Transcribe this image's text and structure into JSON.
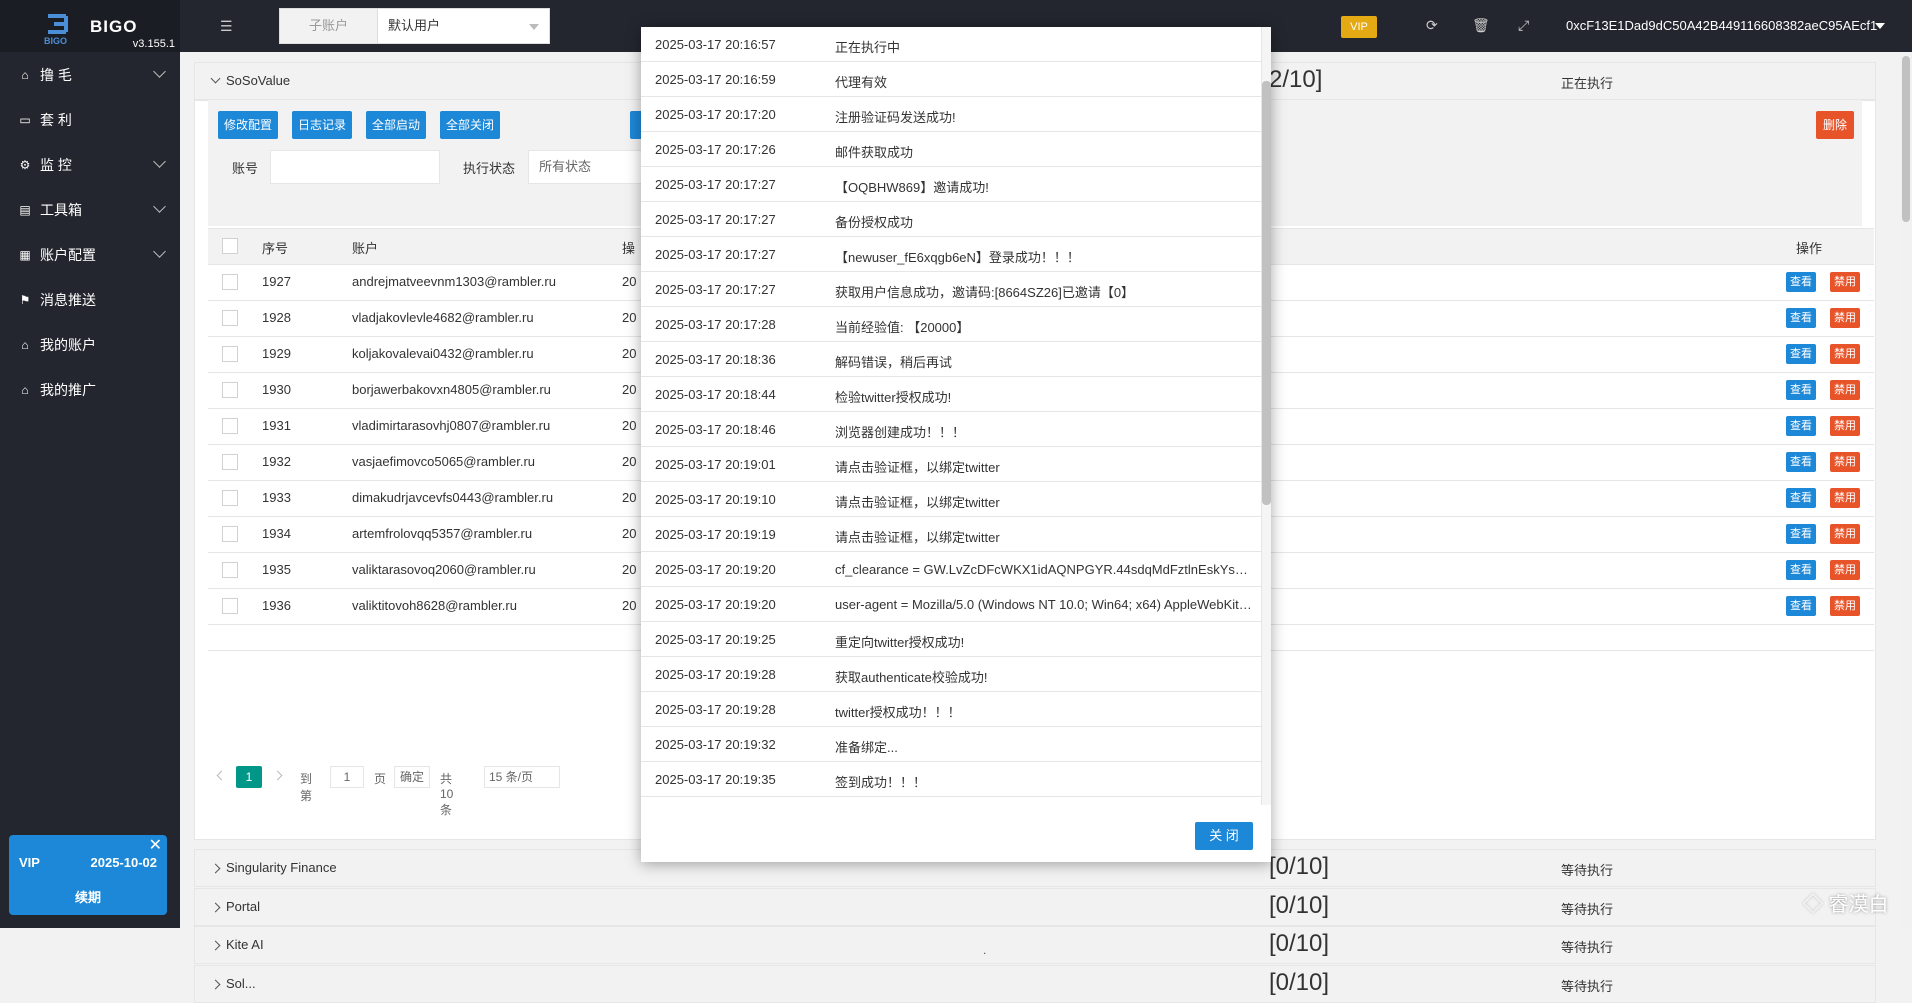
{
  "brand": {
    "name": "BIGO",
    "sub": "BIGO",
    "version": "v3.155.1"
  },
  "sidebar": {
    "items": [
      {
        "label": "撸 毛",
        "icon": "home-icon",
        "glyph": "⌂",
        "has_arrow": true
      },
      {
        "label": "套 利",
        "icon": "window-icon",
        "glyph": "▭",
        "has_arrow": false
      },
      {
        "label": "监 控",
        "icon": "gears-icon",
        "glyph": "⚙",
        "has_arrow": true
      },
      {
        "label": "工具箱",
        "icon": "file-icon",
        "glyph": "▤",
        "has_arrow": true
      },
      {
        "label": "账户配置",
        "icon": "calendar-icon",
        "glyph": "▦",
        "has_arrow": true
      },
      {
        "label": "消息推送",
        "icon": "flag-icon",
        "glyph": "⚑",
        "has_arrow": false
      },
      {
        "label": "我的账户",
        "icon": "home-icon",
        "glyph": "⌂",
        "has_arrow": false
      },
      {
        "label": "我的推广",
        "icon": "home-icon",
        "glyph": "⌂",
        "has_arrow": false
      }
    ],
    "vip": {
      "label": "VIP",
      "date": "2025-10-02",
      "renew": "续期",
      "close": "✕"
    }
  },
  "header": {
    "account_label": "子账户",
    "account_value": "默认用户",
    "vip_badge": "VIP",
    "wallet": "0xcF13E1Dad9dC50A42B449116608382aeC95AEcf1"
  },
  "sections": {
    "top": {
      "name": "SoSoValue",
      "progress": "2/10]",
      "status": "正在执行"
    },
    "others": [
      {
        "name": "Singularity Finance",
        "progress": "[0/10]",
        "status": "等待执行"
      },
      {
        "name": "Portal",
        "progress": "[0/10]",
        "status": "等待执行"
      },
      {
        "name": "Kite AI",
        "progress": "[0/10]",
        "status": "等待执行",
        "dot": "."
      },
      {
        "name": "Sol...",
        "progress": "[0/10]",
        "status": "等待执行"
      }
    ]
  },
  "toolbar": {
    "edit_config": "修改配置",
    "log_record": "日志记录",
    "start_all": "全部启动",
    "close_all": "全部关闭",
    "delete": "删除"
  },
  "filters": {
    "account_label": "账号",
    "account_value": "",
    "status_label": "执行状态",
    "status_value": "所有状态"
  },
  "table": {
    "headers": {
      "seq": "序号",
      "account": "账户",
      "op_partial": "操",
      "actions": "操作"
    },
    "rows": [
      {
        "seq": "1927",
        "account": "andrejmatveevnm1303@rambler.ru",
        "partial": "20"
      },
      {
        "seq": "1928",
        "account": "vladjakovlevle4682@rambler.ru",
        "partial": "20"
      },
      {
        "seq": "1929",
        "account": "koljakovalevai0432@rambler.ru",
        "partial": "20"
      },
      {
        "seq": "1930",
        "account": "borjawerbakovxn4805@rambler.ru",
        "partial": "20"
      },
      {
        "seq": "1931",
        "account": "vladimirtarasovhj0807@rambler.ru",
        "partial": "20"
      },
      {
        "seq": "1932",
        "account": "vasjaefimovco5065@rambler.ru",
        "partial": "20"
      },
      {
        "seq": "1933",
        "account": "dimakudrjavcevfs0443@rambler.ru",
        "partial": "20"
      },
      {
        "seq": "1934",
        "account": "artemfrolovqq5357@rambler.ru",
        "partial": "20"
      },
      {
        "seq": "1935",
        "account": "valiktarasovoq2060@rambler.ru",
        "partial": "20"
      },
      {
        "seq": "1936",
        "account": "valiktitovoh8628@rambler.ru",
        "partial": "20"
      }
    ],
    "view_label": "查看",
    "disable_label": "禁用"
  },
  "pager": {
    "current": "1",
    "goto": "到第",
    "page_input": "1",
    "page_unit": "页",
    "confirm": "确定",
    "total": "共 10 条",
    "per_page": "15 条/页"
  },
  "modal": {
    "close_label": "关 闭",
    "logs": [
      {
        "time": "2025-03-17 20:16:57",
        "msg": "正在执行中"
      },
      {
        "time": "2025-03-17 20:16:59",
        "msg": "代理有效"
      },
      {
        "time": "2025-03-17 20:17:20",
        "msg": "注册验证码发送成功!"
      },
      {
        "time": "2025-03-17 20:17:26",
        "msg": "邮件获取成功"
      },
      {
        "time": "2025-03-17 20:17:27",
        "msg": "【OQBHW869】邀请成功!"
      },
      {
        "time": "2025-03-17 20:17:27",
        "msg": "备份授权成功"
      },
      {
        "time": "2025-03-17 20:17:27",
        "msg": "【newuser_fE6xqgb6eN】登录成功！！！"
      },
      {
        "time": "2025-03-17 20:17:27",
        "msg": "获取用户信息成功，邀请码:[8664SZ26]已邀请【0】"
      },
      {
        "time": "2025-03-17 20:17:28",
        "msg": "当前经验值: 【20000】"
      },
      {
        "time": "2025-03-17 20:18:36",
        "msg": "解码错误，稍后再试"
      },
      {
        "time": "2025-03-17 20:18:44",
        "msg": "检验twitter授权成功!"
      },
      {
        "time": "2025-03-17 20:18:46",
        "msg": "浏览器创建成功！！！"
      },
      {
        "time": "2025-03-17 20:19:01",
        "msg": "请点击验证框，以绑定twitter"
      },
      {
        "time": "2025-03-17 20:19:10",
        "msg": "请点击验证框，以绑定twitter"
      },
      {
        "time": "2025-03-17 20:19:19",
        "msg": "请点击验证框，以绑定twitter"
      },
      {
        "time": "2025-03-17 20:19:20",
        "msg": "cf_clearance = GW.LvZcDFcWKX1idAQNPGYR.44sdqMdFztlnEskYsPU..."
      },
      {
        "time": "2025-03-17 20:19:20",
        "msg": "user-agent = Mozilla/5.0 (Windows NT 10.0; Win64; x64) AppleWebKit/5..."
      },
      {
        "time": "2025-03-17 20:19:25",
        "msg": "重定向twitter授权成功!"
      },
      {
        "time": "2025-03-17 20:19:28",
        "msg": "获取authenticate校验成功!"
      },
      {
        "time": "2025-03-17 20:19:28",
        "msg": "twitter授权成功！！！"
      },
      {
        "time": "2025-03-17 20:19:32",
        "msg": "准备绑定..."
      },
      {
        "time": "2025-03-17 20:19:35",
        "msg": "签到成功！！！"
      }
    ]
  },
  "watermark": "◇ 睿漠白"
}
